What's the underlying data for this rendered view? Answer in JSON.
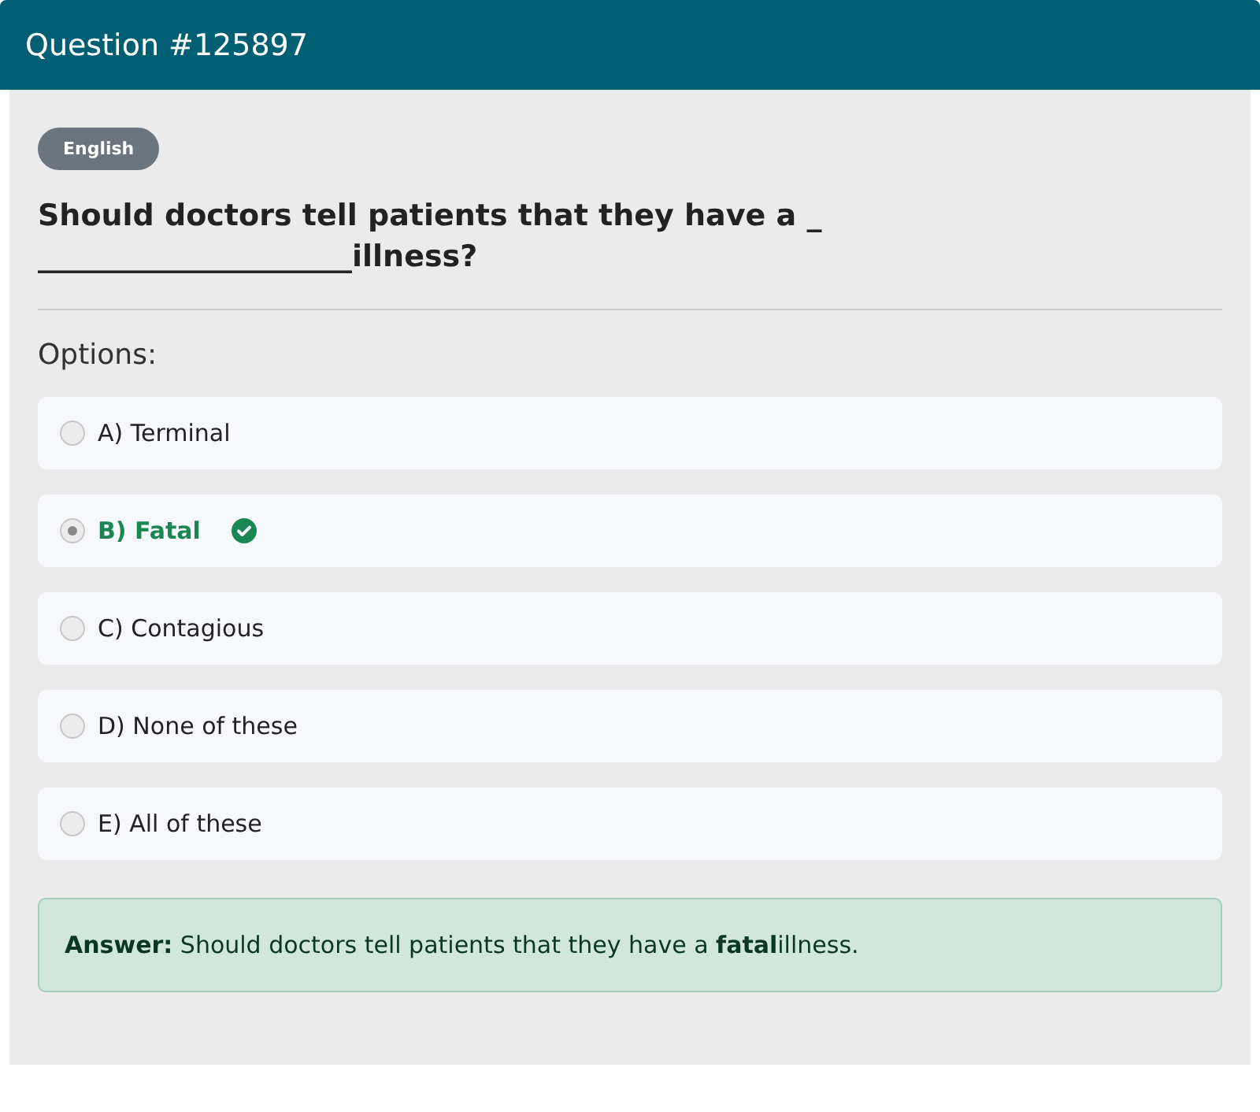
{
  "header": {
    "title": "Question #125897"
  },
  "language_badge": "English",
  "question": "Should doctors tell patients that they have a ______________________illness?",
  "options_label": "Options:",
  "options": [
    {
      "label": "A) Terminal",
      "selected": false,
      "correct": false
    },
    {
      "label": "B) Fatal",
      "selected": true,
      "correct": true
    },
    {
      "label": "C) Contagious",
      "selected": false,
      "correct": false
    },
    {
      "label": "D) None of these",
      "selected": false,
      "correct": false
    },
    {
      "label": "E) All of these",
      "selected": false,
      "correct": false
    }
  ],
  "answer": "**Answer:** Should doctors tell patients that they have a **fatal**illness."
}
